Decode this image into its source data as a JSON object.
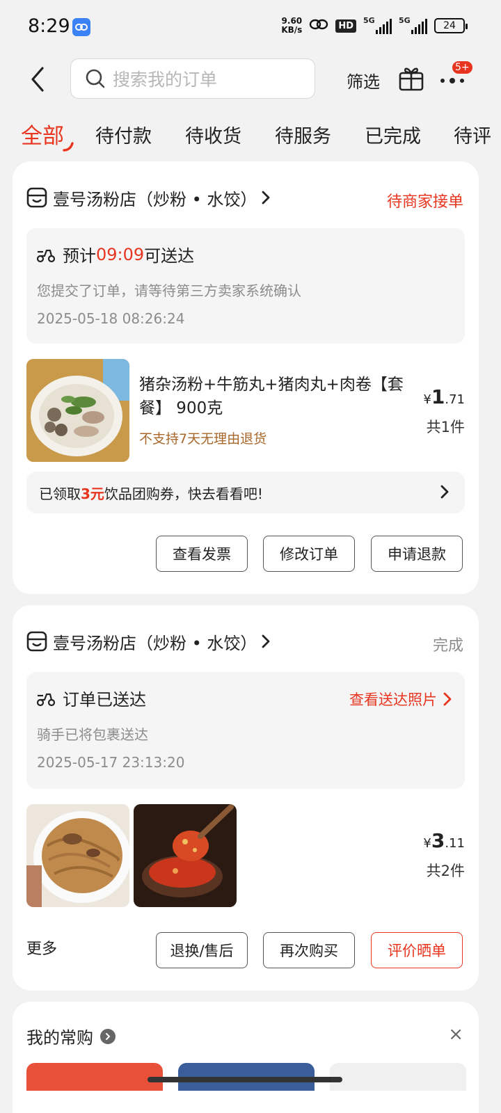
{
  "status_bar": {
    "time": "8:29",
    "net_speed_value": "9.60",
    "net_speed_unit": "KB/s",
    "hd": "HD",
    "sig1": "5G",
    "sig2": "5G",
    "battery": "24"
  },
  "header": {
    "search_placeholder": "搜索我的订单",
    "filter": "筛选",
    "badge": "5+"
  },
  "tabs": [
    "全部",
    "待付款",
    "待收货",
    "待服务",
    "已完成",
    "待评"
  ],
  "orders": [
    {
      "store": "壹号汤粉店（炒粉 • 水饺）",
      "status": "待商家接单",
      "delivery_prefix": "预计",
      "delivery_time": "09:09",
      "delivery_suffix": "可送达",
      "message": "您提交了订单，请等待第三方卖家系统确认",
      "timestamp": "2025-05-18 08:26:24",
      "product_title": "猪杂汤粉+牛筋丸+猪肉丸+肉卷【套餐】 900克",
      "product_note": "不支持7天无理由退货",
      "price_symbol": "¥",
      "price_int": "1",
      "price_dec": ".71",
      "count": "共1件",
      "coupon_prefix": "已领取",
      "coupon_amount": "3元",
      "coupon_suffix": "饮品团购券，快去看看吧!",
      "buttons": [
        "查看发票",
        "修改订单",
        "申请退款"
      ]
    },
    {
      "store": "壹号汤粉店（炒粉 • 水饺）",
      "status": "完成",
      "delivery_text": "订单已送达",
      "photo_link": "查看送达照片",
      "message": "骑手已将包裹送达",
      "timestamp": "2025-05-17 23:13:20",
      "price_symbol": "¥",
      "price_int": "3",
      "price_dec": ".11",
      "count": "共2件",
      "more": "更多",
      "buttons": [
        "退换/售后",
        "再次购买",
        "评价晒单"
      ]
    }
  ],
  "frequent": {
    "title": "我的常购",
    "close": "×"
  },
  "colors": {
    "accent": "#e8351f",
    "note": "#a8662a",
    "background": "#f2f2f2"
  }
}
